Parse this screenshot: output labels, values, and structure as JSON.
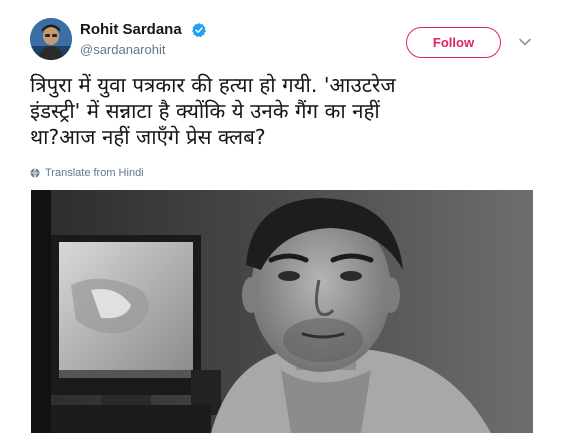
{
  "author": {
    "display_name": "Rohit Sardana",
    "handle": "@sardanarohit",
    "avatar_icon": "user-avatar",
    "verified": true
  },
  "actions": {
    "follow_label": "Follow",
    "more_icon": "chevron-down-icon"
  },
  "tweet": {
    "lines": [
      "त्रिपुरा में युवा पत्रकार की हत्या हो गयी. 'आउटरेज",
      "इंडस्ट्री' में सन्नाटा है क्योंकि ये उनके गैंग का नहीं",
      "था?आज नहीं जाएँगे प्रेस क्लब?"
    ],
    "translate_label": "Translate from Hindi",
    "translate_icon": "globe-icon"
  },
  "media": {
    "type": "photo",
    "description_icon": "photo-image"
  },
  "colors": {
    "follow_accent": "#e0245e",
    "verified_blue": "#1da1f2",
    "secondary_text": "#657786",
    "primary_text": "#14171a"
  }
}
